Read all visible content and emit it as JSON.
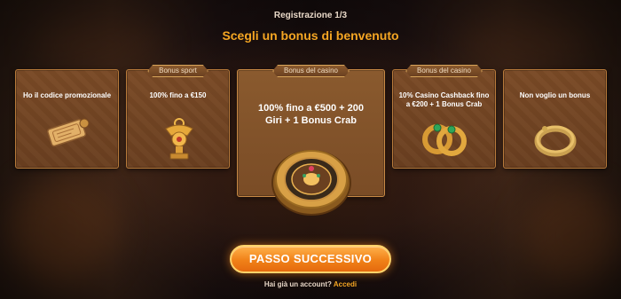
{
  "header": {
    "step": "Registrazione 1/3",
    "title": "Scegli un bonus di benvenuto"
  },
  "cards": [
    {
      "ribbon": "",
      "text": "Ho il codice promozionale",
      "icon": "ticket-scroll-icon"
    },
    {
      "ribbon": "Bonus sport",
      "text": "100% fino a €150",
      "icon": "golden-trophy-icon"
    },
    {
      "ribbon": "Bonus del casino",
      "text": "100% fino a €500 + 200 Giri + 1 Bonus Crab",
      "icon": "roulette-wheel-icon",
      "selected": true
    },
    {
      "ribbon": "Bonus del casino",
      "text": "10% Casino Cashback fino a €200 + 1 Bonus Crab",
      "icon": "emerald-rings-icon"
    },
    {
      "ribbon": "",
      "text": "Non voglio un bonus",
      "icon": "empty-ring-icon"
    }
  ],
  "actions": {
    "next_label": "PASSO SUCCESSIVO",
    "account_prompt": "Hai già un account?",
    "login_label": "Accedi"
  },
  "colors": {
    "accent": "#f5a623",
    "button": "#f08118",
    "card": "#6a3f20"
  }
}
